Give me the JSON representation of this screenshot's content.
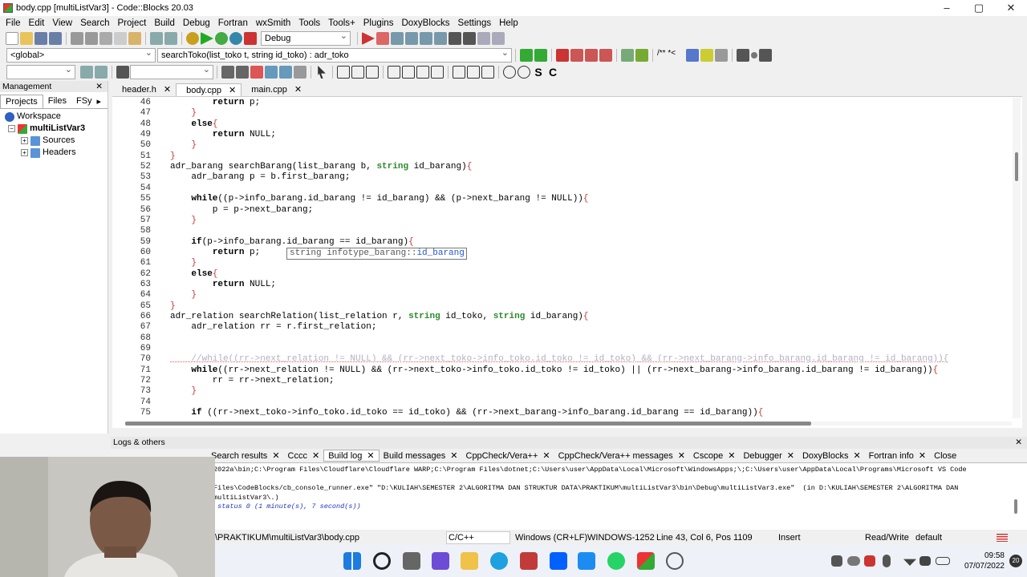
{
  "window": {
    "title": "body.cpp [multiListVar3] - Code::Blocks 20.03"
  },
  "menu": [
    "File",
    "Edit",
    "View",
    "Search",
    "Project",
    "Build",
    "Debug",
    "Fortran",
    "wxSmith",
    "Tools",
    "Tools+",
    "Plugins",
    "DoxyBlocks",
    "Settings",
    "Help"
  ],
  "toolbar": {
    "build_target": "Debug",
    "scope": "<global>",
    "function": "searchToko(list_toko t, string id_toko) : adr_toko"
  },
  "management": {
    "title": "Management",
    "tabs": [
      "Projects",
      "Files",
      "FSy"
    ],
    "tree": {
      "workspace": "Workspace",
      "project": "multiListVar3",
      "folders": [
        "Sources",
        "Headers"
      ]
    }
  },
  "editor": {
    "tabs": [
      "header.h",
      "body.cpp",
      "main.cpp"
    ],
    "active_tab": "body.cpp",
    "lines": [
      {
        "n": "46",
        "t": "        return p;"
      },
      {
        "n": "47",
        "t": "    }"
      },
      {
        "n": "48",
        "t": "    else{"
      },
      {
        "n": "49",
        "t": "        return NULL;"
      },
      {
        "n": "50",
        "t": "    }"
      },
      {
        "n": "51",
        "t": "}"
      },
      {
        "n": "52",
        "t": "adr_barang searchBarang(list_barang b, string id_barang){"
      },
      {
        "n": "53",
        "t": "    adr_barang p = b.first_barang;"
      },
      {
        "n": "54",
        "t": ""
      },
      {
        "n": "55",
        "t": "    while((p->info_barang.id_barang != id_barang) && (p->next_barang != NULL)){"
      },
      {
        "n": "56",
        "t": "        p = p->next_barang;"
      },
      {
        "n": "57",
        "t": "    }"
      },
      {
        "n": "58",
        "t": ""
      },
      {
        "n": "59",
        "t": "    if(p->info_barang.id_barang == id_barang){"
      },
      {
        "n": "60",
        "t": "        return p;"
      },
      {
        "n": "61",
        "t": "    }"
      },
      {
        "n": "62",
        "t": "    else{"
      },
      {
        "n": "63",
        "t": "        return NULL;"
      },
      {
        "n": "64",
        "t": "    }"
      },
      {
        "n": "65",
        "t": "}"
      },
      {
        "n": "66",
        "t": "adr_relation searchRelation(list_relation r, string id_toko, string id_barang){"
      },
      {
        "n": "67",
        "t": "    adr_relation rr = r.first_relation;"
      },
      {
        "n": "68",
        "t": ""
      },
      {
        "n": "69",
        "t": ""
      },
      {
        "n": "70",
        "t": "    //while((rr->next_relation != NULL) && (rr->next_toko->info_toko.id_toko != id_toko) && (rr->next_barang->info_barang.id_barang != id_barang)){"
      },
      {
        "n": "71",
        "t": "    while((rr->next_relation != NULL) && (rr->next_toko->info_toko.id_toko != id_toko) || (rr->next_barang->info_barang.id_barang != id_barang)){"
      },
      {
        "n": "72",
        "t": "        rr = rr->next_relation;"
      },
      {
        "n": "73",
        "t": "    }"
      },
      {
        "n": "74",
        "t": ""
      },
      {
        "n": "75",
        "t": "    if ((rr->next_toko->info_toko.id_toko == id_toko) && (rr->next_barang->info_barang.id_barang == id_barang)){"
      }
    ],
    "tooltip_prefix": "string infotype_barang::",
    "tooltip_member": "id_barang"
  },
  "logs": {
    "title": "Logs & others",
    "tabs": [
      "Search results",
      "Cccc",
      "Build log",
      "Build messages",
      "CppCheck/Vera++",
      "CppCheck/Vera++ messages",
      "Cscope",
      "Debugger",
      "DoxyBlocks",
      "Fortran info",
      "Close"
    ],
    "active_tab": "Build log",
    "lines": [
      "2022a\\bin;C:\\Program Files\\Cloudflare\\Cloudflare WARP;C:\\Program Files\\dotnet;C:\\Users\\user\\AppData\\Local\\Microsoft\\WindowsApps;\\;C:\\Users\\user\\AppData\\Local\\Programs\\Microsoft VS Code",
      "",
      "Files\\CodeBlocks/cb_console_runner.exe\" \"D:\\KULIAH\\SEMESTER 2\\ALGORITMA DAN STRUKTUR DATA\\PRAKTIKUM\\multiListVar3\\bin\\Debug\\multiListVar3.exe\"  (in D:\\KULIAH\\SEMESTER 2\\ALGORITMA DAN",
      "multiListVar3\\.)",
      " status 0 (1 minute(s), 7 second(s))"
    ]
  },
  "status": {
    "path": "\\PRAKTIKUM\\multiListVar3\\body.cpp",
    "lang": "C/C++",
    "eol": "Windows (CR+LF)",
    "encoding": "WINDOWS-1252",
    "position": "Line 43, Col 6, Pos 1109",
    "mode": "Insert",
    "access": "Read/Write",
    "profile": "default"
  },
  "taskbar": {
    "time": "09:58",
    "date": "07/07/2022",
    "notif": "20"
  }
}
